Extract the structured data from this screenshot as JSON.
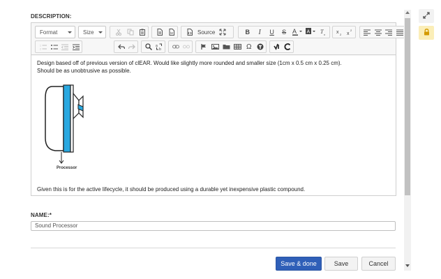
{
  "description_label": "DESCRIPTION:",
  "toolbar": {
    "format_label": "Format",
    "size_label": "Size",
    "source_label": "Source"
  },
  "content": {
    "paragraph1": "Design based off of previous version of clEAR. Would like slightly more rounded and smaller size (1cm x 0.5 cm x 0.25 cm).",
    "paragraph2": "Should be as unobtrusive as possible.",
    "illustration_caption": "Processor",
    "paragraph3": "Given this is for the active lifecycle, it should be produced using a durable yet inexpensive plastic compound."
  },
  "name_label": "NAME:*",
  "name_value": "Sound Processor",
  "buttons": {
    "save_done": "Save & done",
    "save": "Save",
    "cancel": "Cancel"
  },
  "colors": {
    "primary_button": "#2f5fb8",
    "lock_button": "#fbeeb8",
    "device_accent": "#29a8e0"
  },
  "icons": {
    "expand": "expand-icon",
    "lock": "lock-icon"
  }
}
